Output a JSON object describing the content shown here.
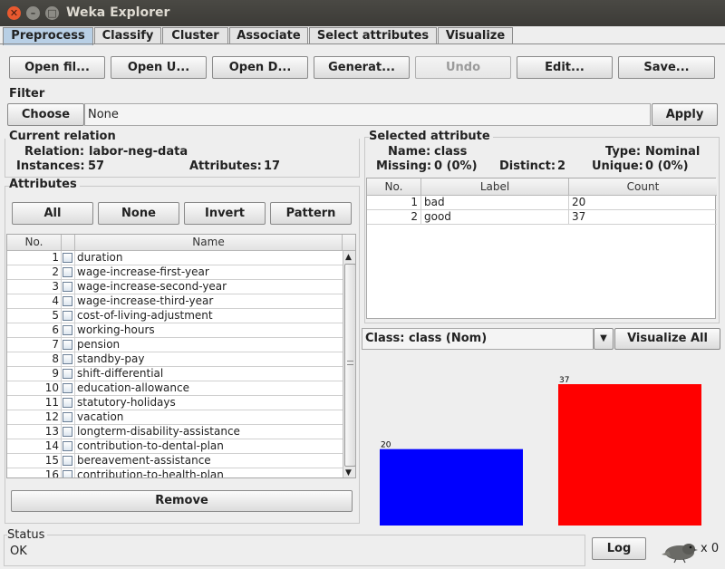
{
  "window": {
    "title": "Weka Explorer"
  },
  "tabs": [
    "Preprocess",
    "Classify",
    "Cluster",
    "Associate",
    "Select attributes",
    "Visualize"
  ],
  "toolbar": {
    "open_file": "Open fil...",
    "open_url": "Open U...",
    "open_db": "Open D...",
    "generate": "Generat...",
    "undo": "Undo",
    "edit": "Edit...",
    "save": "Save..."
  },
  "filter": {
    "label": "Filter",
    "choose": "Choose",
    "value": "None",
    "apply": "Apply"
  },
  "current_relation": {
    "label": "Current relation",
    "relation_label": "Relation:",
    "relation_value": "labor-neg-data",
    "instances_label": "Instances:",
    "instances_value": "57",
    "attributes_label": "Attributes:",
    "attributes_value": "17"
  },
  "attributes": {
    "label": "Attributes",
    "all": "All",
    "none": "None",
    "invert": "Invert",
    "pattern": "Pattern",
    "col_no": "No.",
    "col_name": "Name",
    "rows": [
      {
        "no": "1",
        "name": "duration"
      },
      {
        "no": "2",
        "name": "wage-increase-first-year"
      },
      {
        "no": "3",
        "name": "wage-increase-second-year"
      },
      {
        "no": "4",
        "name": "wage-increase-third-year"
      },
      {
        "no": "5",
        "name": "cost-of-living-adjustment"
      },
      {
        "no": "6",
        "name": "working-hours"
      },
      {
        "no": "7",
        "name": "pension"
      },
      {
        "no": "8",
        "name": "standby-pay"
      },
      {
        "no": "9",
        "name": "shift-differential"
      },
      {
        "no": "10",
        "name": "education-allowance"
      },
      {
        "no": "11",
        "name": "statutory-holidays"
      },
      {
        "no": "12",
        "name": "vacation"
      },
      {
        "no": "13",
        "name": "longterm-disability-assistance"
      },
      {
        "no": "14",
        "name": "contribution-to-dental-plan"
      },
      {
        "no": "15",
        "name": "bereavement-assistance"
      },
      {
        "no": "16",
        "name": "contribution-to-health-plan"
      }
    ],
    "remove": "Remove"
  },
  "selected_attribute": {
    "label": "Selected attribute",
    "name_label": "Name:",
    "name_value": "class",
    "type_label": "Type:",
    "type_value": "Nominal",
    "missing_label": "Missing:",
    "missing_value": "0 (0%)",
    "distinct_label": "Distinct:",
    "distinct_value": "2",
    "unique_label": "Unique:",
    "unique_value": "0 (0%)",
    "col_no": "No.",
    "col_label": "Label",
    "col_count": "Count",
    "rows": [
      {
        "no": "1",
        "label": "bad",
        "count": "20"
      },
      {
        "no": "2",
        "label": "good",
        "count": "37"
      }
    ]
  },
  "class_select": {
    "value": "Class: class (Nom)",
    "visualize_all": "Visualize All"
  },
  "chart_data": {
    "type": "bar",
    "categories": [
      "bad",
      "good"
    ],
    "values": [
      20,
      37
    ],
    "colors": [
      "#0000ff",
      "#ff0000"
    ],
    "ylim": [
      0,
      37
    ]
  },
  "status": {
    "label": "Status",
    "value": "OK",
    "log": "Log",
    "count": "x 0"
  }
}
